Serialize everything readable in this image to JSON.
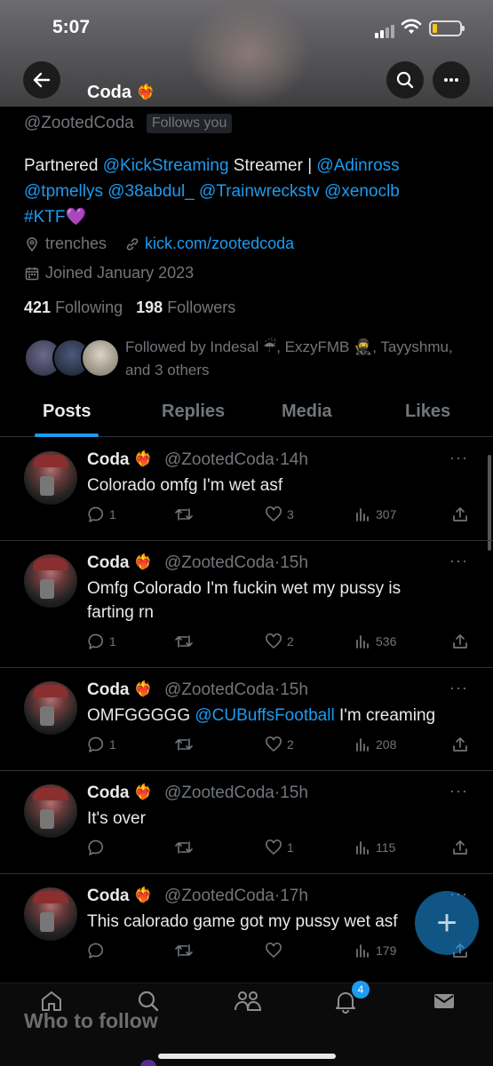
{
  "status_bar": {
    "time": "5:07"
  },
  "header": {
    "name": "Coda",
    "name_emoji": "❤️‍🔥"
  },
  "profile": {
    "handle": "@ZootedCoda",
    "follows_you": "Follows you",
    "bio": {
      "t1": "Partnered ",
      "m1": "@KickStreaming",
      "t2": " Streamer | ",
      "m2": "@Adinross",
      "m3": "@tpmellys",
      "m4": "@38abdul_",
      "m5": "@Trainwreckstv",
      "m6": "@xenoclb",
      "tag": "#KTF",
      "tag_emoji": "💜"
    },
    "location": "trenches",
    "website": "kick.com/zootedcoda",
    "joined": "Joined January 2023",
    "following_count": "421",
    "following_label": "Following",
    "followers_count": "198",
    "followers_label": "Followers",
    "followed_by": "Followed by Indesal ☔, ExzyFMB 🥷, Tayyshmu, and 3 others"
  },
  "tabs": [
    {
      "label": "Posts",
      "active": true
    },
    {
      "label": "Replies"
    },
    {
      "label": "Media"
    },
    {
      "label": "Likes"
    }
  ],
  "posts": [
    {
      "name": "Coda",
      "handle": "@ZootedCoda",
      "time": "14h",
      "text": "Colorado omfg I'm wet asf",
      "replies": "1",
      "reposts": "",
      "likes": "3",
      "views": "307"
    },
    {
      "name": "Coda",
      "handle": "@ZootedCoda",
      "time": "15h",
      "text": "Omfg Colorado I'm fuckin wet my pussy is farting rn",
      "replies": "1",
      "reposts": "",
      "likes": "2",
      "views": "536"
    },
    {
      "name": "Coda",
      "handle": "@ZootedCoda",
      "time": "15h",
      "text_pre": "OMFGGGGG ",
      "mention": "@CUBuffsFootball",
      "text_post": " I'm creaming",
      "replies": "1",
      "reposts": "",
      "likes": "2",
      "views": "208"
    },
    {
      "name": "Coda",
      "handle": "@ZootedCoda",
      "time": "15h",
      "text": "It's over",
      "replies": "",
      "reposts": "",
      "likes": "1",
      "views": "115"
    },
    {
      "name": "Coda",
      "handle": "@ZootedCoda",
      "time": "17h",
      "text": "This calorado game got my pussy wet asf",
      "replies": "",
      "reposts": "",
      "likes": "",
      "views": "179"
    }
  ],
  "fab": {
    "icon": "+"
  },
  "bottom_nav": {
    "notifications_badge": "4",
    "who_to_follow": "Who to follow"
  },
  "colors": {
    "accent": "#1d9bf0",
    "muted": "#71767b",
    "text": "#e7e9ea",
    "background": "#000000"
  }
}
